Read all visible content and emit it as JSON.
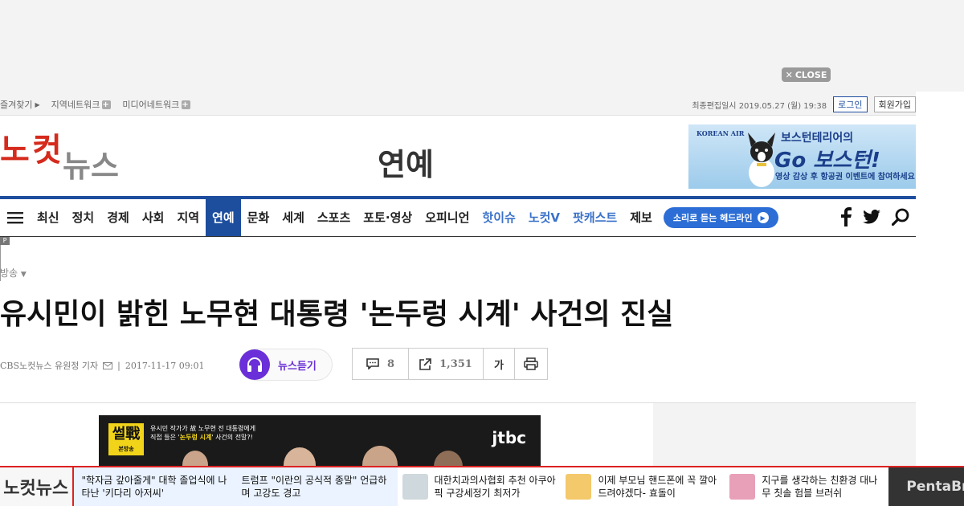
{
  "ad_close": {
    "label": "CLOSE"
  },
  "utility": {
    "bookmark": "즐겨찾기",
    "region_network": "지역네트워크",
    "media_network": "미디어네트워크",
    "last_edited": "최종편집일시 2019.05.27 (월) 19:38",
    "login": "로그인",
    "signup": "회원가입"
  },
  "header": {
    "logo_text": "노컷뉴스",
    "section_title": "연예",
    "banner": {
      "brand": "KOREAN AIR",
      "line1": "보스턴테리어의",
      "line2": "Go 보스턴!",
      "line3": "영상 감상 후 항공권 이벤트에 참여하세요"
    }
  },
  "nav": {
    "items": [
      {
        "label": "최신",
        "active": false,
        "blue": false
      },
      {
        "label": "정치",
        "active": false,
        "blue": false
      },
      {
        "label": "경제",
        "active": false,
        "blue": false
      },
      {
        "label": "사회",
        "active": false,
        "blue": false
      },
      {
        "label": "지역",
        "active": false,
        "blue": false
      },
      {
        "label": "연예",
        "active": true,
        "blue": false
      },
      {
        "label": "문화",
        "active": false,
        "blue": false
      },
      {
        "label": "세계",
        "active": false,
        "blue": false
      },
      {
        "label": "스포츠",
        "active": false,
        "blue": false
      },
      {
        "label": "포토·영상",
        "active": false,
        "blue": false
      },
      {
        "label": "오피니언",
        "active": false,
        "blue": false
      },
      {
        "label": "핫이슈",
        "active": false,
        "blue": true
      },
      {
        "label": "노컷V",
        "active": false,
        "blue": true
      },
      {
        "label": "팟캐스트",
        "active": false,
        "blue": true
      },
      {
        "label": "제보",
        "active": false,
        "blue": false
      }
    ],
    "audio_headline": "소리로 듣는 헤드라인",
    "accent": "#1d4e9e"
  },
  "article": {
    "p_badge": "P",
    "category": "방송",
    "headline": "유시민이 밝힌 노무현 대통령 '논두렁 시계' 사건의 진실",
    "byline": "CBS노컷뉴스 유원정 기자",
    "date": "2017-11-17 09:01",
    "listen_label": "뉴스듣기",
    "comments": "8",
    "shares": "1,351",
    "font_size_label": "가"
  },
  "video": {
    "tag": "썰戰",
    "tag_sub": "본방송",
    "caption1": "유시민 작가가 故 노무현 전 대통령에게",
    "caption2_pre": "직접 들은 '",
    "caption2_hl": "논두렁 시계",
    "caption2_post": "' 사건의 전말?!",
    "channel": "jtbc"
  },
  "ticker": {
    "logo": "노컷뉴스",
    "items": [
      {
        "text": "\"학자금 갚아줄게\" 대학 졸업식에 나타난 '키다리 아저씨'",
        "thumb": false,
        "hl": true
      },
      {
        "text": "트럼프 \"이란의 공식적 종말\" 언급하며 고강도 경고",
        "thumb": false,
        "hl": true
      },
      {
        "text": "대한치과의사협회 추천 아쿠아픽 구강세정기 최저가",
        "thumb": true,
        "hl": false
      },
      {
        "text": "이제 부모님 핸드폰에 꼭 깔아드려야겠다- 효돌이",
        "thumb": true,
        "hl": false
      },
      {
        "text": "지구를 생각하는 친환경 대나무 칫솔 험블 브러쉬",
        "thumb": true,
        "hl": false
      }
    ],
    "sponsor": "PentaBr"
  }
}
